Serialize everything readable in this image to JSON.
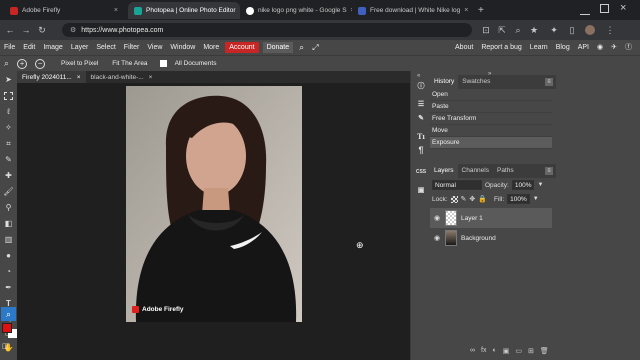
{
  "browser": {
    "tabs": [
      {
        "title": "Adobe Firefly",
        "favicon_color": "#c82525"
      },
      {
        "title": "Photopea | Online Photo Editor",
        "favicon_color": "#18a497"
      },
      {
        "title": "nike logo png white - Google S",
        "favicon_color": "#ffffff"
      },
      {
        "title": "Free download | White Nike log",
        "favicon_color": "#4060c0"
      }
    ],
    "new_tab": "+",
    "url": "https://www.photopea.com"
  },
  "menu": {
    "items": [
      "File",
      "Edit",
      "Image",
      "Layer",
      "Select",
      "Filter",
      "View",
      "Window",
      "More"
    ],
    "account": "Account",
    "donate": "Donate",
    "right_links": [
      "About",
      "Report a bug",
      "Learn",
      "Blog",
      "API"
    ]
  },
  "options": {
    "pixel_to_pixel": "Pixel to Pixel",
    "fit_area": "Fit The Area",
    "all_documents": "All Documents"
  },
  "documents": [
    {
      "title": "Firefly 2024011...",
      "close": "×"
    },
    {
      "title": "black-and-white-...",
      "close": "×"
    }
  ],
  "photo": {
    "watermark": "Adobe Firefly"
  },
  "history": {
    "tabs": [
      "History",
      "Swatches"
    ],
    "entries": [
      "Open",
      "Paste",
      "Free Transform",
      "Move",
      "Exposure"
    ],
    "selected": "Exposure"
  },
  "layers": {
    "tabs": [
      "Layers",
      "Channels",
      "Paths"
    ],
    "blend_mode": "Normal",
    "opacity_label": "Opacity:",
    "opacity": "100%",
    "lock_label": "Lock:",
    "fill_label": "Fill:",
    "fill": "100%",
    "items": [
      "Layer 1",
      "Background"
    ]
  },
  "colors": {
    "accent_red": "#c82525",
    "foreground": "#e01010",
    "background": "#ffffff",
    "panel_bg": "#474747"
  }
}
